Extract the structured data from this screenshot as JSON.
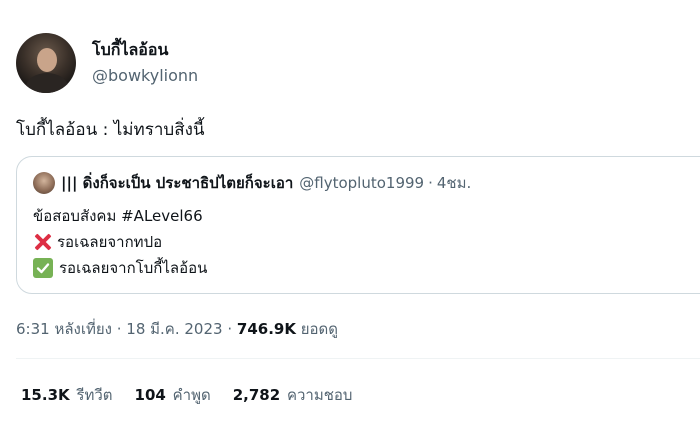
{
  "author": {
    "display_name": "โบกี้ไลอ้อน",
    "handle": "@bowkylionn"
  },
  "tweet": {
    "text": "โบกี้ไลอ้อน : ไม่ทราบสิ่งนี้"
  },
  "quote": {
    "display_name": "||| ดิ่งก็จะเป็น ประชาธิปไตยก็จะเอา",
    "handle": "@flytopluto1999",
    "separator": "·",
    "time": "4ชม.",
    "lines": [
      "ข้อสอบสังคม #ALevel66",
      "รอเฉลยจากทปอ",
      "รอเฉลยจากโบกี้ไลอ้อน"
    ],
    "icons": [
      "cross-mark-icon",
      "check-mark-icon"
    ]
  },
  "meta": {
    "timestamp": "6:31 หลังเที่ยง · 18 มี.ค. 2023",
    "separator": "·",
    "views_count": "746.9K",
    "views_label": "ยอดดู"
  },
  "stats": {
    "retweets_count": "15.3K",
    "retweets_label": "รีทวีต",
    "quotes_count": "104",
    "quotes_label": "คำพูด",
    "likes_count": "2,782",
    "likes_label": "ความชอบ"
  },
  "colors": {
    "text": "#0f1419",
    "secondary": "#536471",
    "border": "#cfd9de",
    "cross": "#dd2e44",
    "check": "#77b255"
  }
}
